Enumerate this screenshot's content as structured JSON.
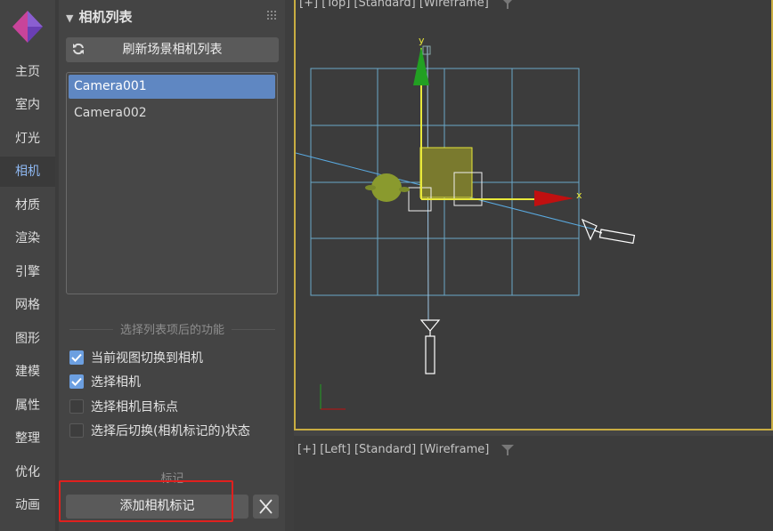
{
  "sidebar": {
    "items": [
      {
        "label": "主页"
      },
      {
        "label": "室内"
      },
      {
        "label": "灯光"
      },
      {
        "label": "相机",
        "active": true
      },
      {
        "label": "材质"
      },
      {
        "label": "渲染"
      },
      {
        "label": "引擎"
      },
      {
        "label": "网格"
      },
      {
        "label": "图形"
      },
      {
        "label": "建模"
      },
      {
        "label": "属性"
      },
      {
        "label": "整理"
      },
      {
        "label": "优化"
      },
      {
        "label": "动画"
      }
    ]
  },
  "panel": {
    "title": "相机列表",
    "refresh_label": "刷新场景相机列表",
    "cameras": [
      {
        "name": "Camera001",
        "selected": true
      },
      {
        "name": "Camera002",
        "selected": false
      }
    ],
    "section_label": "选择列表项后的功能",
    "options": [
      {
        "label": "当前视图切换到相机",
        "checked": true
      },
      {
        "label": "选择相机",
        "checked": true
      },
      {
        "label": "选择相机目标点",
        "checked": false
      },
      {
        "label": "选择后切换(相机标记的)状态",
        "checked": false
      }
    ],
    "mark_label": "标记",
    "add_mark_label": "添加相机标记"
  },
  "viewports": {
    "top": {
      "plus": "[+]",
      "view": "[Top]",
      "shading": "[Standard]",
      "mode": "[Wireframe]",
      "axis_x": "x",
      "axis_y": "y"
    },
    "left": {
      "plus": "[+]",
      "view": "[Left]",
      "shading": "[Standard]",
      "mode": "[Wireframe]"
    }
  },
  "colors": {
    "accent": "#6c9fe0",
    "selected_row": "#5f87c2",
    "active_viewport": "#c9ad42",
    "highlight": "#e0201e"
  }
}
